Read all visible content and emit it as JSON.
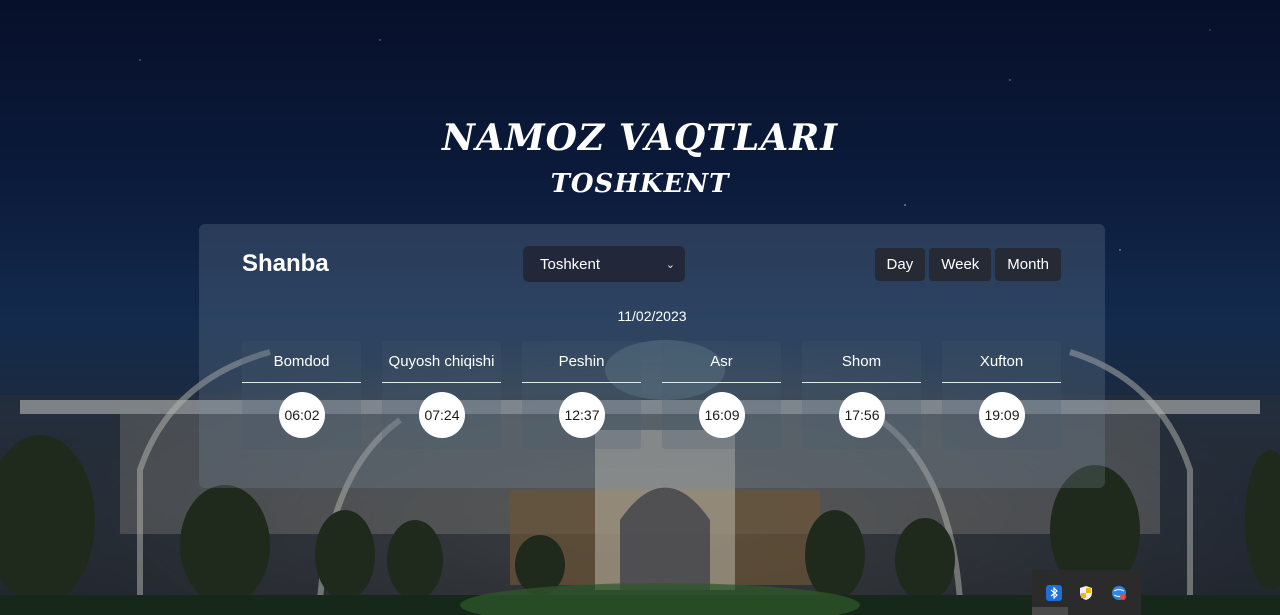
{
  "header": {
    "title": "NAMOZ VAQTLARI",
    "city": "TOSHKENT"
  },
  "card": {
    "day_name": "Shanba",
    "selected_city": "Toshkent",
    "date": "11/02/2023",
    "range_buttons": [
      "Day",
      "Week",
      "Month"
    ],
    "prayers": [
      {
        "name": "Bomdod",
        "time": "06:02"
      },
      {
        "name": "Quyosh chiqishi",
        "time": "07:24"
      },
      {
        "name": "Peshin",
        "time": "12:37"
      },
      {
        "name": "Asr",
        "time": "16:09"
      },
      {
        "name": "Shom",
        "time": "17:56"
      },
      {
        "name": "Xufton",
        "time": "19:09"
      }
    ]
  },
  "tray": {
    "icons": [
      "bluetooth-icon",
      "security-shield-icon",
      "network-globe-icon"
    ]
  },
  "colors": {
    "sky_top": "#07102a",
    "card_bg": "rgba(120,140,160,0.26)",
    "button_bg": "#252a35",
    "select_bg": "#22283a"
  }
}
